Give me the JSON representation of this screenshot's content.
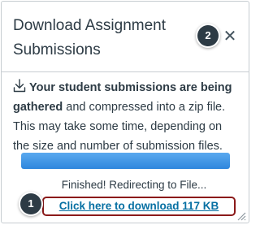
{
  "dialog": {
    "title": "Download Assignment Submissions",
    "close_icon": "close-icon",
    "close_glyph": "✕"
  },
  "callouts": {
    "one": "1",
    "two": "2"
  },
  "message": {
    "icon": "download-icon",
    "bold_text": "Your student submissions are being gathered",
    "rest_text": " and compressed into a zip file. This may take some time, depending on the size and number of submission files."
  },
  "progress": {
    "percent": 100,
    "color": "#2e86dd"
  },
  "status": {
    "text": "Finished! Redirecting to File..."
  },
  "download_link": {
    "label": "Click here to download 117 KB"
  },
  "colors": {
    "text": "#2d3b45",
    "link": "#0770a3",
    "highlight_border": "#8b1a1a",
    "callout_bg": "#2d3b45"
  }
}
